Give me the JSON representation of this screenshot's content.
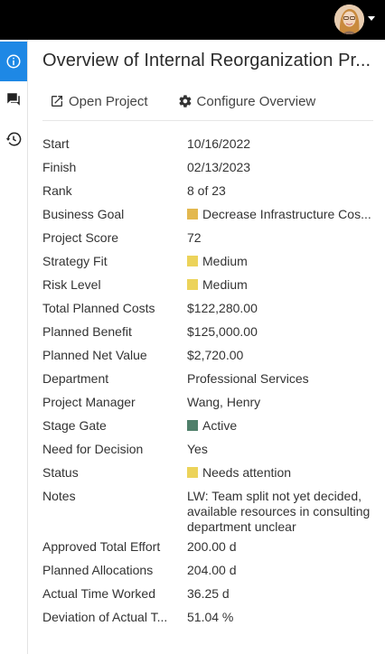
{
  "title": "Overview of Internal Reorganization Pr...",
  "actions": {
    "open_project": "Open Project",
    "configure_overview": "Configure Overview"
  },
  "fields": [
    {
      "label": "Start",
      "value": "10/16/2022"
    },
    {
      "label": "Finish",
      "value": "02/13/2023"
    },
    {
      "label": "Rank",
      "value": "8 of 23"
    },
    {
      "label": "Business Goal",
      "value": "Decrease Infrastructure Cos...",
      "color": "#e3b84f"
    },
    {
      "label": "Project Score",
      "value": "72"
    },
    {
      "label": "Strategy Fit",
      "value": "Medium",
      "color": "#ecd35a"
    },
    {
      "label": "Risk Level",
      "value": "Medium",
      "color": "#ecd35a"
    },
    {
      "label": "Total Planned Costs",
      "value": "$122,280.00"
    },
    {
      "label": "Planned Benefit",
      "value": "$125,000.00"
    },
    {
      "label": "Planned Net Value",
      "value": "$2,720.00"
    },
    {
      "label": "Department",
      "value": "Professional Services"
    },
    {
      "label": "Project Manager",
      "value": "Wang, Henry"
    },
    {
      "label": "Stage Gate",
      "value": "Active",
      "color": "#4f7f6a"
    },
    {
      "label": "Need for Decision",
      "value": "Yes"
    },
    {
      "label": "Status",
      "value": "Needs attention",
      "color": "#ecd35a"
    },
    {
      "label": "Notes",
      "value": "LW: Team split not yet decided, available resources in consulting department unclear"
    },
    {
      "label": "Approved Total Effort",
      "value": "200.00 d"
    },
    {
      "label": "Planned Allocations",
      "value": "204.00 d"
    },
    {
      "label": "Actual Time Worked",
      "value": "36.25 d"
    },
    {
      "label": "Deviation of Actual T...",
      "value": "51.04 %"
    }
  ],
  "icons": {
    "rail": [
      "info-icon",
      "comments-icon",
      "history-icon"
    ],
    "actions": [
      "open-in-new-icon",
      "gear-icon"
    ]
  },
  "colors": {
    "rail_active": "#1e88e5",
    "topbar": "#000000"
  }
}
